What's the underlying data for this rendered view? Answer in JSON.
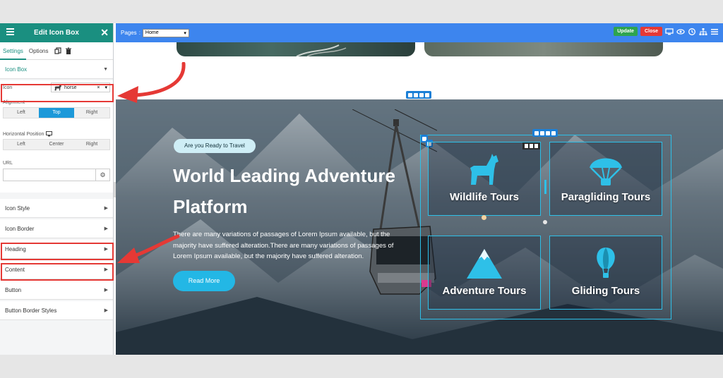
{
  "sidebar": {
    "title": "Edit Icon Box",
    "tabs": [
      {
        "label": "Settings",
        "active": true
      },
      {
        "label": "Options",
        "active": false
      }
    ],
    "section_open": "Icon Box",
    "icon_field": {
      "label": "Icon",
      "value": "horse",
      "clear": "×",
      "caret": "▾"
    },
    "alignment": {
      "label": "Alignment",
      "options": [
        "Left",
        "Top",
        "Right"
      ],
      "selected": "Top"
    },
    "horizontal_position": {
      "label": "Horizontal Position",
      "options": [
        "Left",
        "Center",
        "Right"
      ]
    },
    "url": {
      "label": "URL",
      "value": ""
    },
    "sections": [
      "Icon Style",
      "Icon Border",
      "Heading",
      "Content",
      "Button",
      "Button Border Styles"
    ],
    "collapse_glyph": "‹"
  },
  "topbar": {
    "pages_label": "Pages",
    "page_selected": "Home",
    "update_label": "Update",
    "close_label": "Close"
  },
  "hero": {
    "pill": "Are you Ready to Travel",
    "title": "World Leading Adventure Platform",
    "text": "There are many variations of passages of Lorem Ipsum available, but the majority have suffered alteration.There are many variations of passages of Lorem Ipsum available, but the majority have suffered alteration.",
    "button": "Read More"
  },
  "boxes": [
    {
      "title": "Wildlife Tours",
      "icon": "horse-icon"
    },
    {
      "title": "Paragliding Tours",
      "icon": "parachute-icon"
    },
    {
      "title": "Adventure Tours",
      "icon": "mountain-icon"
    },
    {
      "title": "Gliding Tours",
      "icon": "hot-air-balloon-icon"
    }
  ],
  "colors": {
    "sidebar_header": "#1a8f80",
    "topbar": "#3d85ee",
    "update": "#2ea44f",
    "close": "#e53935",
    "accent": "#23b7e5",
    "highlight": "#e53935"
  }
}
